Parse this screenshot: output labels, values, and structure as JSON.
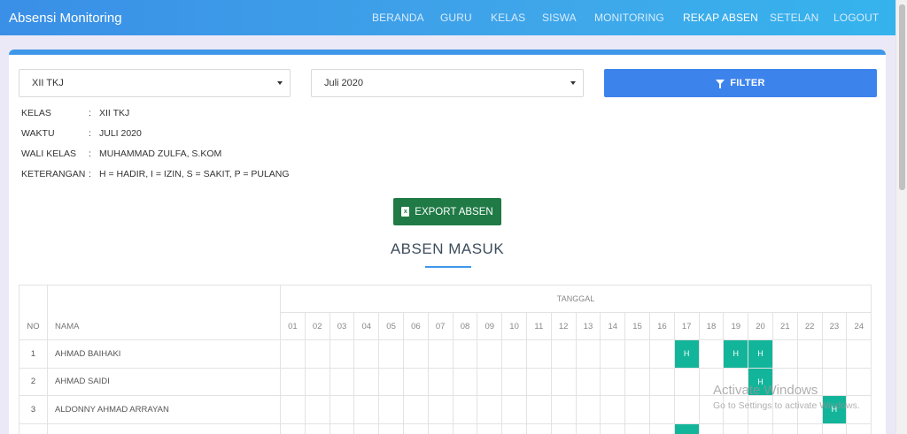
{
  "navbar": {
    "brand": "Absensi Monitoring",
    "items": [
      "BERANDA",
      "GURU",
      "KELAS",
      "SISWA",
      "MONITORING",
      "REKAP ABSEN",
      "SETELAN",
      "LOGOUT"
    ],
    "active": "REKAP ABSEN"
  },
  "filters": {
    "kelas_value": "XII TKJ",
    "bulan_value": "Juli 2020",
    "filter_label": "FILTER"
  },
  "info": [
    {
      "key": "KELAS",
      "sep": ":",
      "value": "XII TKJ"
    },
    {
      "key": "WAKTU",
      "sep": ":",
      "value": "JULI 2020"
    },
    {
      "key": "WALI KELAS",
      "sep": ":",
      "value": "MUHAMMAD ZULFA, S.KOM"
    },
    {
      "key": "KETERANGAN",
      "sep": ":",
      "value": "H = HADIR, I = IZIN, S = SAKIT, P = PULANG"
    }
  ],
  "export_label": "EXPORT ABSEN",
  "export_icon": "excel-icon",
  "section_title": "ABSEN MASUK",
  "table": {
    "header_no": "NO",
    "header_nama": "NAMA",
    "header_tanggal": "TANGGAL",
    "days": [
      "01",
      "02",
      "03",
      "04",
      "05",
      "06",
      "07",
      "08",
      "09",
      "10",
      "11",
      "12",
      "13",
      "14",
      "15",
      "16",
      "17",
      "18",
      "19",
      "20",
      "21",
      "22",
      "23",
      "24"
    ],
    "rows": [
      {
        "no": "1",
        "nama": "AHMAD BAIHAKI",
        "marks": {
          "17": "H",
          "19": "H",
          "20": "H"
        }
      },
      {
        "no": "2",
        "nama": "AHMAD SAIDI",
        "marks": {
          "20": "H"
        }
      },
      {
        "no": "3",
        "nama": "ALDONNY AHMAD ARRAYAN",
        "marks": {
          "23": "H"
        }
      },
      {
        "no": "",
        "nama": "",
        "marks": {
          "17": ""
        }
      }
    ],
    "mark_color": "#13b59a"
  },
  "watermark": {
    "title": "Activate Windows",
    "subtitle": "Go to Settings to activate Windows."
  },
  "colors": {
    "nav_start": "#3a8fe6",
    "nav_end": "#35b3ec",
    "filter_button": "#3d83ec",
    "export_button": "#1f7a45",
    "accent": "#3f97ea"
  }
}
